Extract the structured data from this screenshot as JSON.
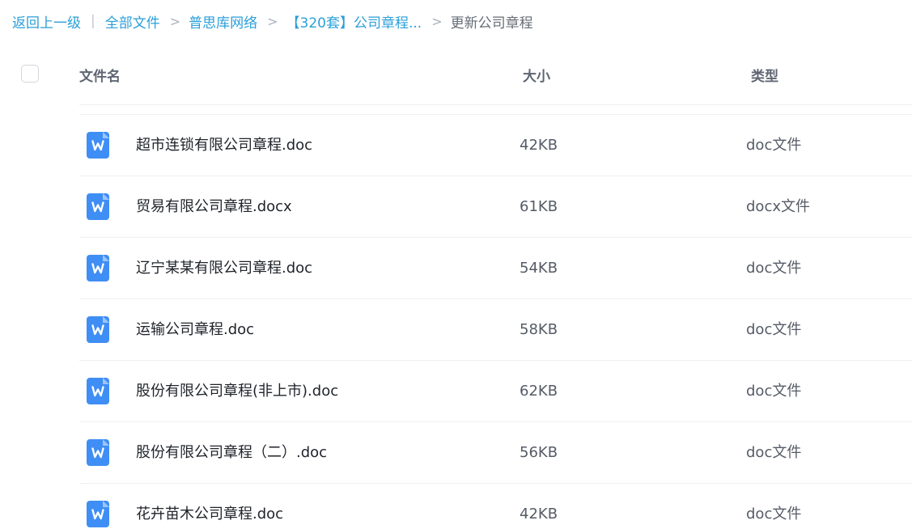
{
  "breadcrumb": {
    "back": "返回上一级",
    "pipe": "|",
    "items": [
      "全部文件",
      "普思库网络",
      "【320套】公司章程..."
    ],
    "current": "更新公司章程",
    "separator": ">"
  },
  "table": {
    "headers": {
      "name": "文件名",
      "size": "大小",
      "type": "类型"
    },
    "rows": [
      {
        "name": "超市连锁有限公司章程.doc",
        "size": "42KB",
        "type": "doc文件",
        "icon": "word-file-icon"
      },
      {
        "name": "贸易有限公司章程.docx",
        "size": "61KB",
        "type": "docx文件",
        "icon": "word-file-icon"
      },
      {
        "name": "辽宁某某有限公司章程.doc",
        "size": "54KB",
        "type": "doc文件",
        "icon": "word-file-icon"
      },
      {
        "name": "运输公司章程.doc",
        "size": "58KB",
        "type": "doc文件",
        "icon": "word-file-icon"
      },
      {
        "name": "股份有限公司章程(非上市).doc",
        "size": "62KB",
        "type": "doc文件",
        "icon": "word-file-icon"
      },
      {
        "name": "股份有限公司章程（二）.doc",
        "size": "56KB",
        "type": "doc文件",
        "icon": "word-file-icon"
      },
      {
        "name": "花卉苗木公司章程.doc",
        "size": "42KB",
        "type": "doc文件",
        "icon": "word-file-icon"
      }
    ]
  },
  "colors": {
    "link": "#2b9fd9",
    "icon_blue": "#3f8ef5"
  }
}
